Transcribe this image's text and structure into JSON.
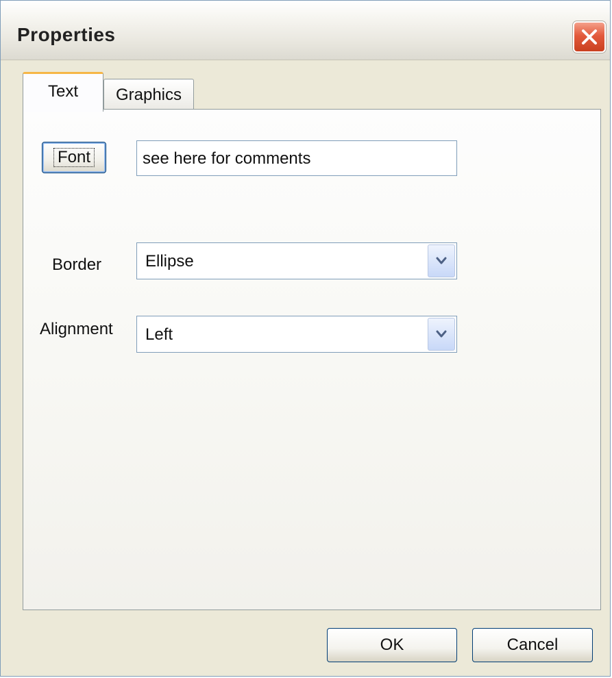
{
  "window": {
    "title": "Properties",
    "close_icon": "close-icon"
  },
  "tabs": [
    {
      "label": "Text",
      "active": true
    },
    {
      "label": "Graphics",
      "active": false
    }
  ],
  "text_tab": {
    "font_button_label": "Font",
    "comment_value": "see here for comments",
    "border_label": "Border",
    "border_value": "Ellipse",
    "alignment_label": "Alignment",
    "alignment_value": "Left"
  },
  "footer": {
    "ok_label": "OK",
    "cancel_label": "Cancel"
  },
  "colors": {
    "close_button": "#e35a3c",
    "active_tab_accent": "#f6b646",
    "focus_border": "#003c74"
  }
}
